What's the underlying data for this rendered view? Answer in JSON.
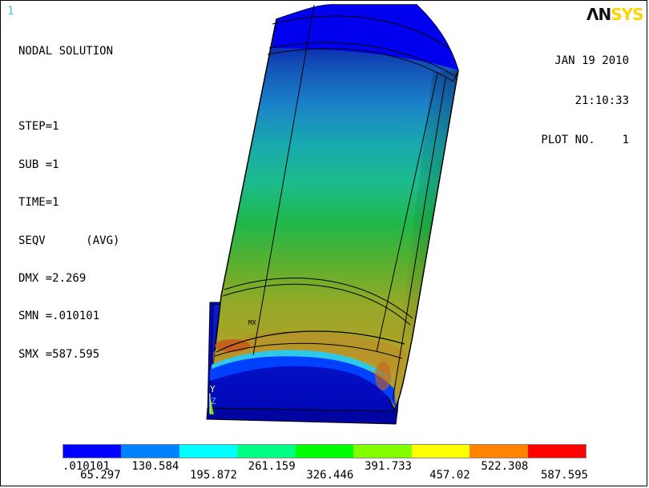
{
  "window": {
    "number": "1"
  },
  "logo": {
    "part1": "ΛN",
    "part2": "SYS"
  },
  "info": {
    "lines": [
      "NODAL SOLUTION",
      "",
      "STEP=1",
      "SUB =1",
      "TIME=1",
      "SEQV      (AVG)",
      "DMX =2.269",
      "SMN =.010101",
      "SMX =587.595"
    ]
  },
  "header": {
    "date": "JAN 19 2010",
    "time": "21:10:33",
    "plot_no": "PLOT NO.    1"
  },
  "triad": {
    "y": "Y",
    "z": "Z"
  },
  "model_mark": "MX",
  "legend": {
    "colors": [
      "#0000ff",
      "#0082ff",
      "#00ffff",
      "#00ff82",
      "#00ff00",
      "#82ff00",
      "#ffff00",
      "#ff8200",
      "#ff0000"
    ],
    "labels_top": [
      ".010101",
      "130.584",
      "261.159",
      "391.733",
      "522.308"
    ],
    "labels_bottom": [
      "65.297",
      "195.872",
      "326.446",
      "457.02",
      "587.595"
    ]
  }
}
